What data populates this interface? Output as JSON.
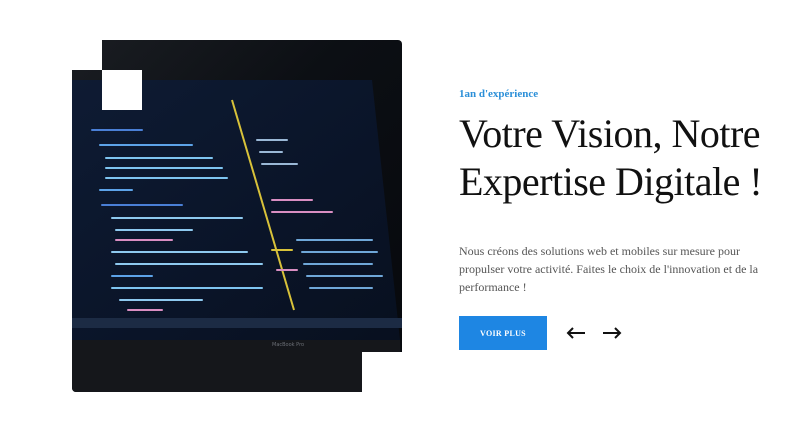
{
  "hero": {
    "eyebrow": "1an d'expérience",
    "headline_line1": "Votre Vision, Notre",
    "headline_line2": "Expertise Digitale !",
    "description": "Nous créons des solutions web et mobiles sur mesure pour propulser votre activité. Faites le choix de l'innovation et de la performance !",
    "cta_label": "VOIR PLUS",
    "prev_icon": "arrow-left-icon",
    "next_icon": "arrow-right-icon",
    "image_subject": "laptop-screen-with-code",
    "laptop_brand_text": "MacBook Pro"
  },
  "colors": {
    "accent": "#1e86e3",
    "eyebrow": "#2b8fd8",
    "headline": "#111111",
    "body_text": "#555555"
  }
}
